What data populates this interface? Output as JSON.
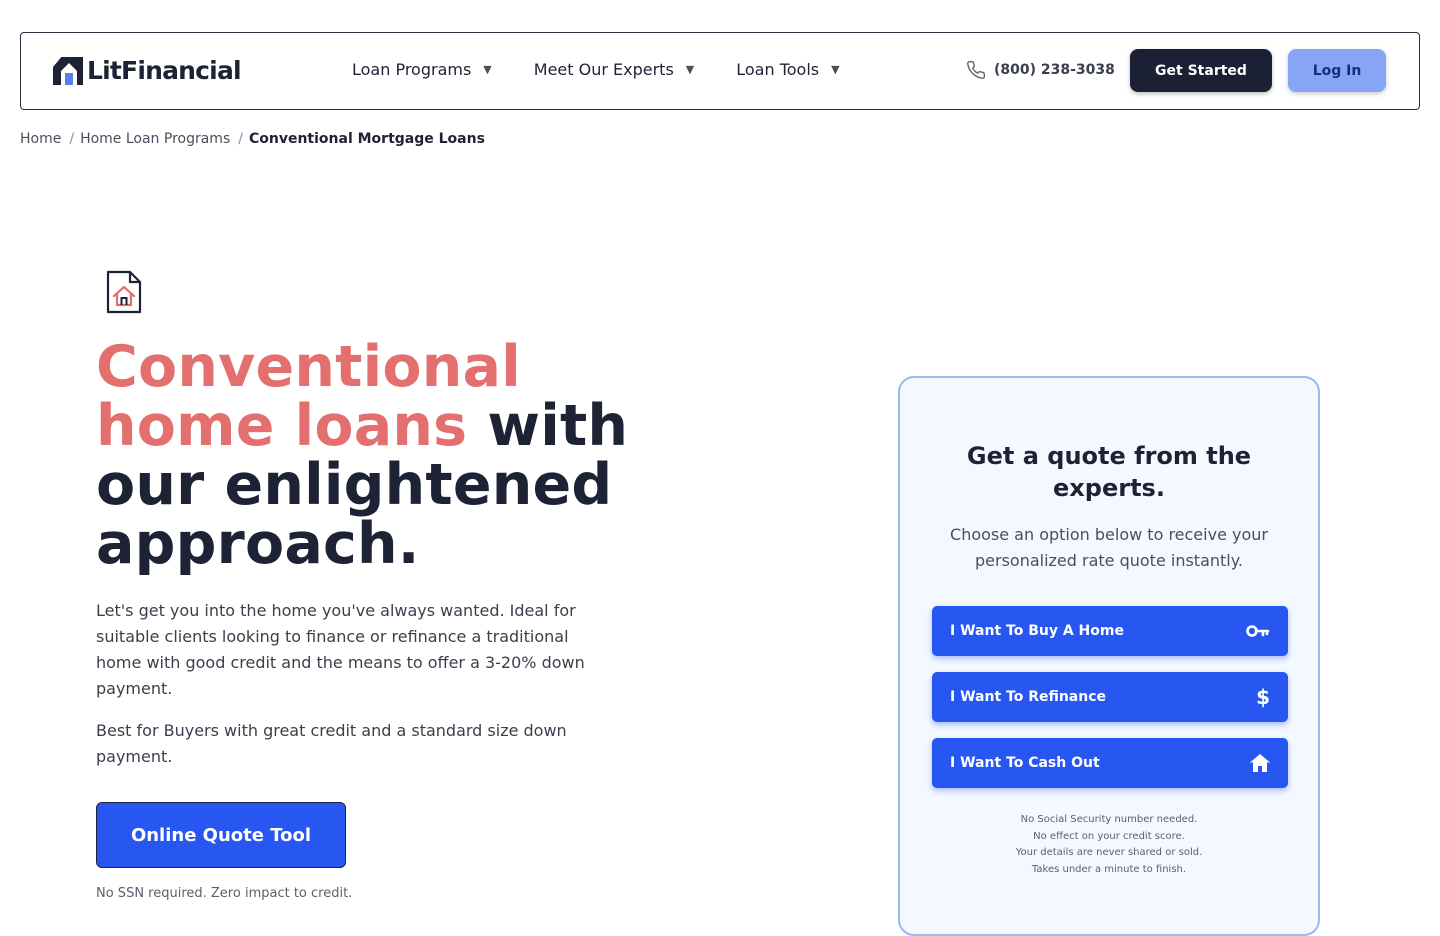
{
  "header": {
    "logo_text": "LitFinancial",
    "nav": [
      {
        "label": "Loan Programs"
      },
      {
        "label": "Meet Our Experts"
      },
      {
        "label": "Loan Tools"
      }
    ],
    "phone": "(800) 238-3038",
    "get_started_label": "Get Started",
    "login_label": "Log In"
  },
  "breadcrumb": {
    "home": "Home",
    "programs": "Home Loan Programs",
    "current": "Conventional Mortgage Loans"
  },
  "hero": {
    "title_line1_accent": "Conventional",
    "title_line2_accent": "home loans",
    "title_line2_rest": " with",
    "title_line3": "our enlightened",
    "title_line4": "approach.",
    "paragraph1": "Let's get you into the home you've always wanted. Ideal for suitable clients looking to finance or refinance a traditional home with good credit and the means to offer a 3-20% down payment.",
    "paragraph2": "Best for Buyers with great credit and a standard size down payment.",
    "cta_label": "Online Quote Tool",
    "note": "No SSN required. Zero impact to credit."
  },
  "quote_card": {
    "title_line1": "Get a quote from the",
    "title_line2": "experts.",
    "subtitle_line1": "Choose an option below to receive your",
    "subtitle_line2": "personalized rate quote instantly.",
    "options": [
      {
        "label": "I Want To Buy A Home",
        "icon": "key-icon"
      },
      {
        "label": "I Want To Refinance",
        "icon": "dollar-icon"
      },
      {
        "label": "I Want To Cash Out",
        "icon": "home-icon"
      }
    ],
    "notes": [
      "No Social Security number needed.",
      "No effect on your credit score.",
      "Your details are never shared or sold.",
      "Takes under a minute to finish."
    ]
  },
  "colors": {
    "accent_coral": "#e36f6f",
    "primary_blue": "#2757f0",
    "navy": "#1c2035",
    "login_blue": "#86a6f5"
  }
}
